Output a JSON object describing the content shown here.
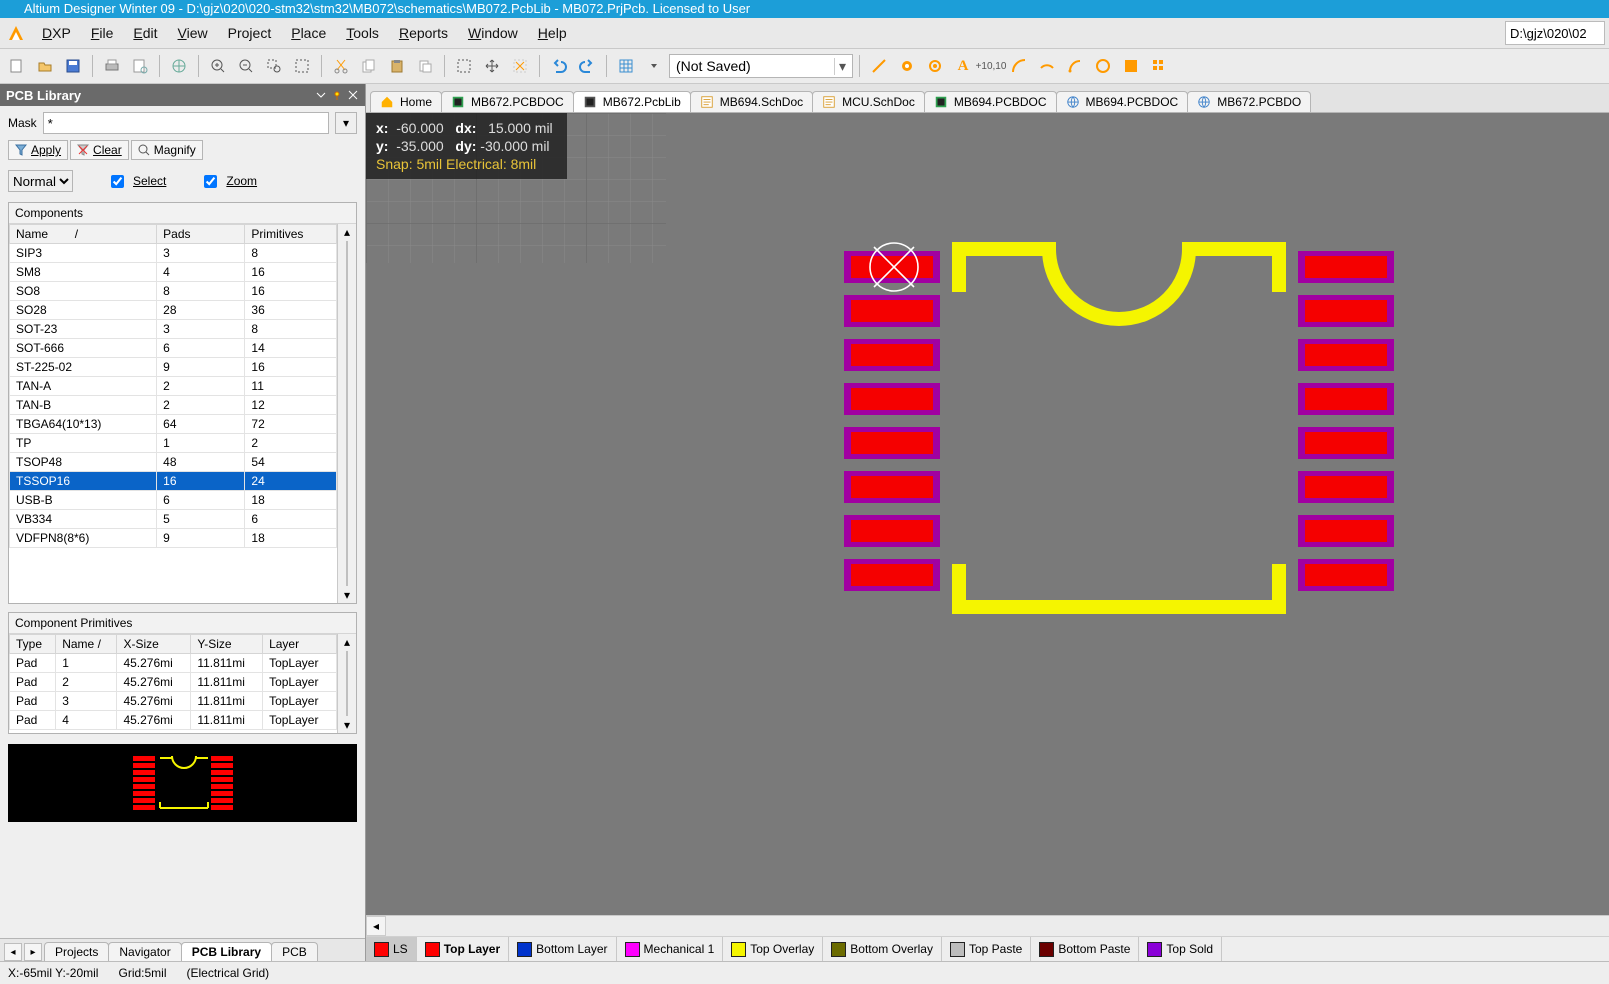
{
  "window": {
    "title": "Altium Designer Winter 09 - D:\\gjz\\020\\020-stm32\\stm32\\MB072\\schematics\\MB072.PcbLib - MB072.PrjPcb. Licensed to User",
    "path_box": "D:\\gjz\\020\\02"
  },
  "menu": {
    "items": [
      "DXP",
      "File",
      "Edit",
      "View",
      "Project",
      "Place",
      "Tools",
      "Reports",
      "Window",
      "Help"
    ],
    "accel": [
      "D",
      "F",
      "E",
      "V",
      "C",
      "P",
      "T",
      "R",
      "W",
      "H"
    ]
  },
  "toolbar": {
    "snapshot_combo": "(Not Saved)"
  },
  "panel": {
    "title": "PCB Library",
    "mask_label": "Mask",
    "mask_value": "*",
    "apply": "Apply",
    "clear": "Clear",
    "magnify": "Magnify",
    "mode": "Normal",
    "select": "Select",
    "zoom": "Zoom",
    "components_header": "Components",
    "col": {
      "name": "Name",
      "pads": "Pads",
      "prims": "Primitives",
      "sort": "/"
    },
    "rows": [
      {
        "n": "SIP3",
        "p": "3",
        "r": "8"
      },
      {
        "n": "SM8",
        "p": "4",
        "r": "16"
      },
      {
        "n": "SO8",
        "p": "8",
        "r": "16"
      },
      {
        "n": "SO28",
        "p": "28",
        "r": "36"
      },
      {
        "n": "SOT-23",
        "p": "3",
        "r": "8"
      },
      {
        "n": "SOT-666",
        "p": "6",
        "r": "14"
      },
      {
        "n": "ST-225-02",
        "p": "9",
        "r": "16"
      },
      {
        "n": "TAN-A",
        "p": "2",
        "r": "11"
      },
      {
        "n": "TAN-B",
        "p": "2",
        "r": "12"
      },
      {
        "n": "TBGA64(10*13)",
        "p": "64",
        "r": "72"
      },
      {
        "n": "TP",
        "p": "1",
        "r": "2"
      },
      {
        "n": "TSOP48",
        "p": "48",
        "r": "54"
      },
      {
        "n": "TSSOP16",
        "p": "16",
        "r": "24",
        "sel": true
      },
      {
        "n": "USB-B",
        "p": "6",
        "r": "18"
      },
      {
        "n": "VB334",
        "p": "5",
        "r": "6"
      },
      {
        "n": "VDFPN8(8*6)",
        "p": "9",
        "r": "18"
      }
    ],
    "prim_header": "Component Primitives",
    "pcol": {
      "type": "Type",
      "name": "Name",
      "sort": "/",
      "xs": "X-Size",
      "ys": "Y-Size",
      "layer": "Layer"
    },
    "prows": [
      {
        "t": "Pad",
        "n": "1",
        "x": "45.276mi",
        "y": "11.811mi",
        "l": "TopLayer"
      },
      {
        "t": "Pad",
        "n": "2",
        "x": "45.276mi",
        "y": "11.811mi",
        "l": "TopLayer"
      },
      {
        "t": "Pad",
        "n": "3",
        "x": "45.276mi",
        "y": "11.811mi",
        "l": "TopLayer"
      },
      {
        "t": "Pad",
        "n": "4",
        "x": "45.276mi",
        "y": "11.811mi",
        "l": "TopLayer"
      }
    ],
    "bottom_tabs": [
      "Projects",
      "Navigator",
      "PCB Library",
      "PCB"
    ],
    "bottom_active": 2
  },
  "doctabs": [
    {
      "label": "Home",
      "icon": "home"
    },
    {
      "label": "MB672.PCBDOC",
      "icon": "pcb"
    },
    {
      "label": "MB672.PcbLib",
      "icon": "pcblib",
      "active": true
    },
    {
      "label": "MB694.SchDoc",
      "icon": "sch"
    },
    {
      "label": "MCU.SchDoc",
      "icon": "sch"
    },
    {
      "label": "MB694.PCBDOC",
      "icon": "pcb"
    },
    {
      "label": "MB694.PCBDOC",
      "icon": "html"
    },
    {
      "label": "MB672.PCBDO",
      "icon": "html"
    }
  ],
  "hud": {
    "x": "-60.000",
    "dx": "15.000",
    "y": "-35.000",
    "dy": "-30.000",
    "unit": "mil",
    "snap": "Snap: 5mil Electrical: 8mil"
  },
  "layers": [
    {
      "name": "LS",
      "color": "#ff0000",
      "ls": true
    },
    {
      "name": "Top Layer",
      "color": "#ff0000",
      "active": true
    },
    {
      "name": "Bottom Layer",
      "color": "#0033cc"
    },
    {
      "name": "Mechanical 1",
      "color": "#ff00ff"
    },
    {
      "name": "Top Overlay",
      "color": "#f5f500"
    },
    {
      "name": "Bottom Overlay",
      "color": "#6b6b00"
    },
    {
      "name": "Top Paste",
      "color": "#bdbdbd"
    },
    {
      "name": "Bottom Paste",
      "color": "#6b0000"
    },
    {
      "name": "Top Sold",
      "color": "#8a00d8"
    }
  ],
  "status": {
    "xy": "X:-65mil Y:-20mil",
    "grid": "Grid:5mil",
    "egrid": "(Electrical Grid)"
  }
}
